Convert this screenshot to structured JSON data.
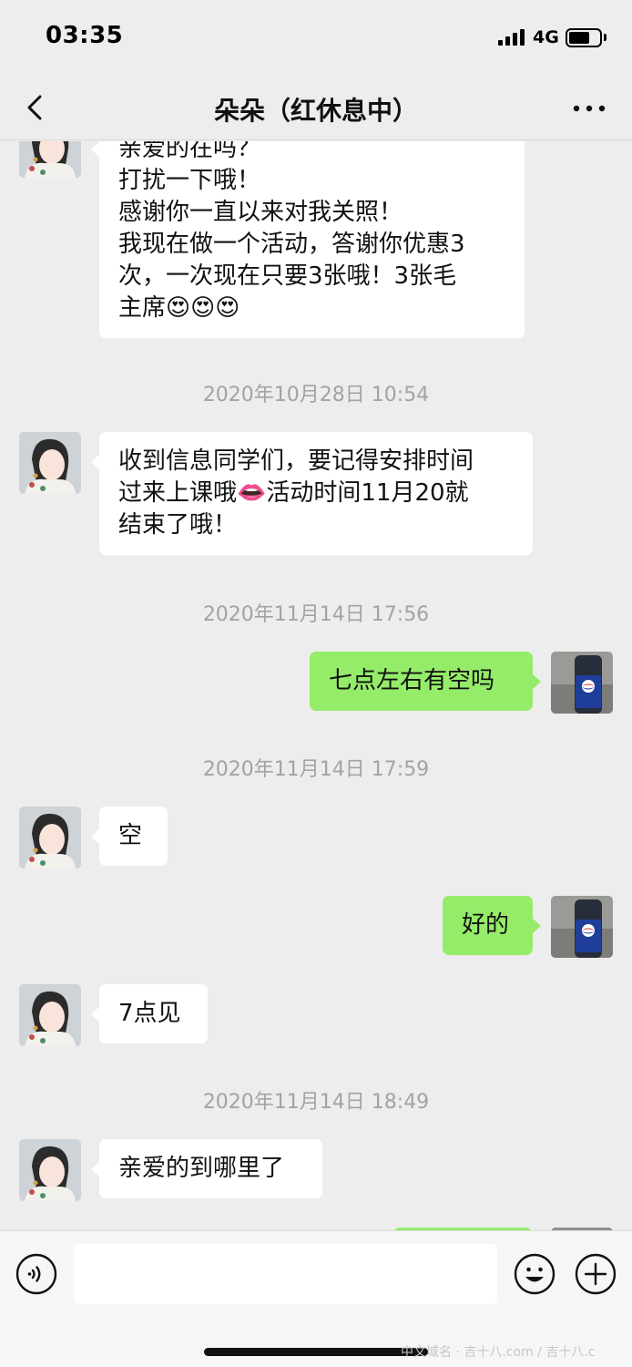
{
  "status_bar": {
    "time": "03:35",
    "network": "4G",
    "battery_level": 0.6
  },
  "header": {
    "title": "朵朵（红休息中）",
    "back_icon": "chevron-left-icon",
    "more_icon": "more-dots-icon"
  },
  "messages": [
    {
      "from": "contact",
      "text": "亲爱的在吗？\n打扰一下哦！\n感谢你一直以来对我关照！\n我现在做一个活动，答谢你优惠3\n次，一次现在只要3张哦！3张毛\n主席😍😍😍"
    },
    {
      "type": "timestamp",
      "text": "2020年10月28日 10:54"
    },
    {
      "from": "contact",
      "text": "收到信息同学们，要记得安排时间\n过来上课哦👄活动时间11月20就\n结束了哦！"
    },
    {
      "type": "timestamp",
      "text": "2020年11月14日 17:56"
    },
    {
      "from": "me",
      "text": "七点左右有空吗"
    },
    {
      "type": "timestamp",
      "text": "2020年11月14日 17:59"
    },
    {
      "from": "contact",
      "text": "空"
    },
    {
      "from": "me",
      "text": "好的"
    },
    {
      "from": "contact",
      "text": "7点见"
    },
    {
      "type": "timestamp",
      "text": "2020年11月14日 18:49"
    },
    {
      "from": "contact",
      "text": "亲爱的到哪里了"
    }
  ],
  "input_bar": {
    "voice_icon": "voice-icon",
    "emoji_icon": "emoji-icon",
    "plus_icon": "plus-icon",
    "message_value": ""
  },
  "watermark": "中文域名 · 吉十八.com / 吉十八.c",
  "colors": {
    "background": "#ededed",
    "incoming_bubble": "#ffffff",
    "outgoing_bubble": "#95ec69",
    "timestamp_text": "#a3a3a3"
  }
}
